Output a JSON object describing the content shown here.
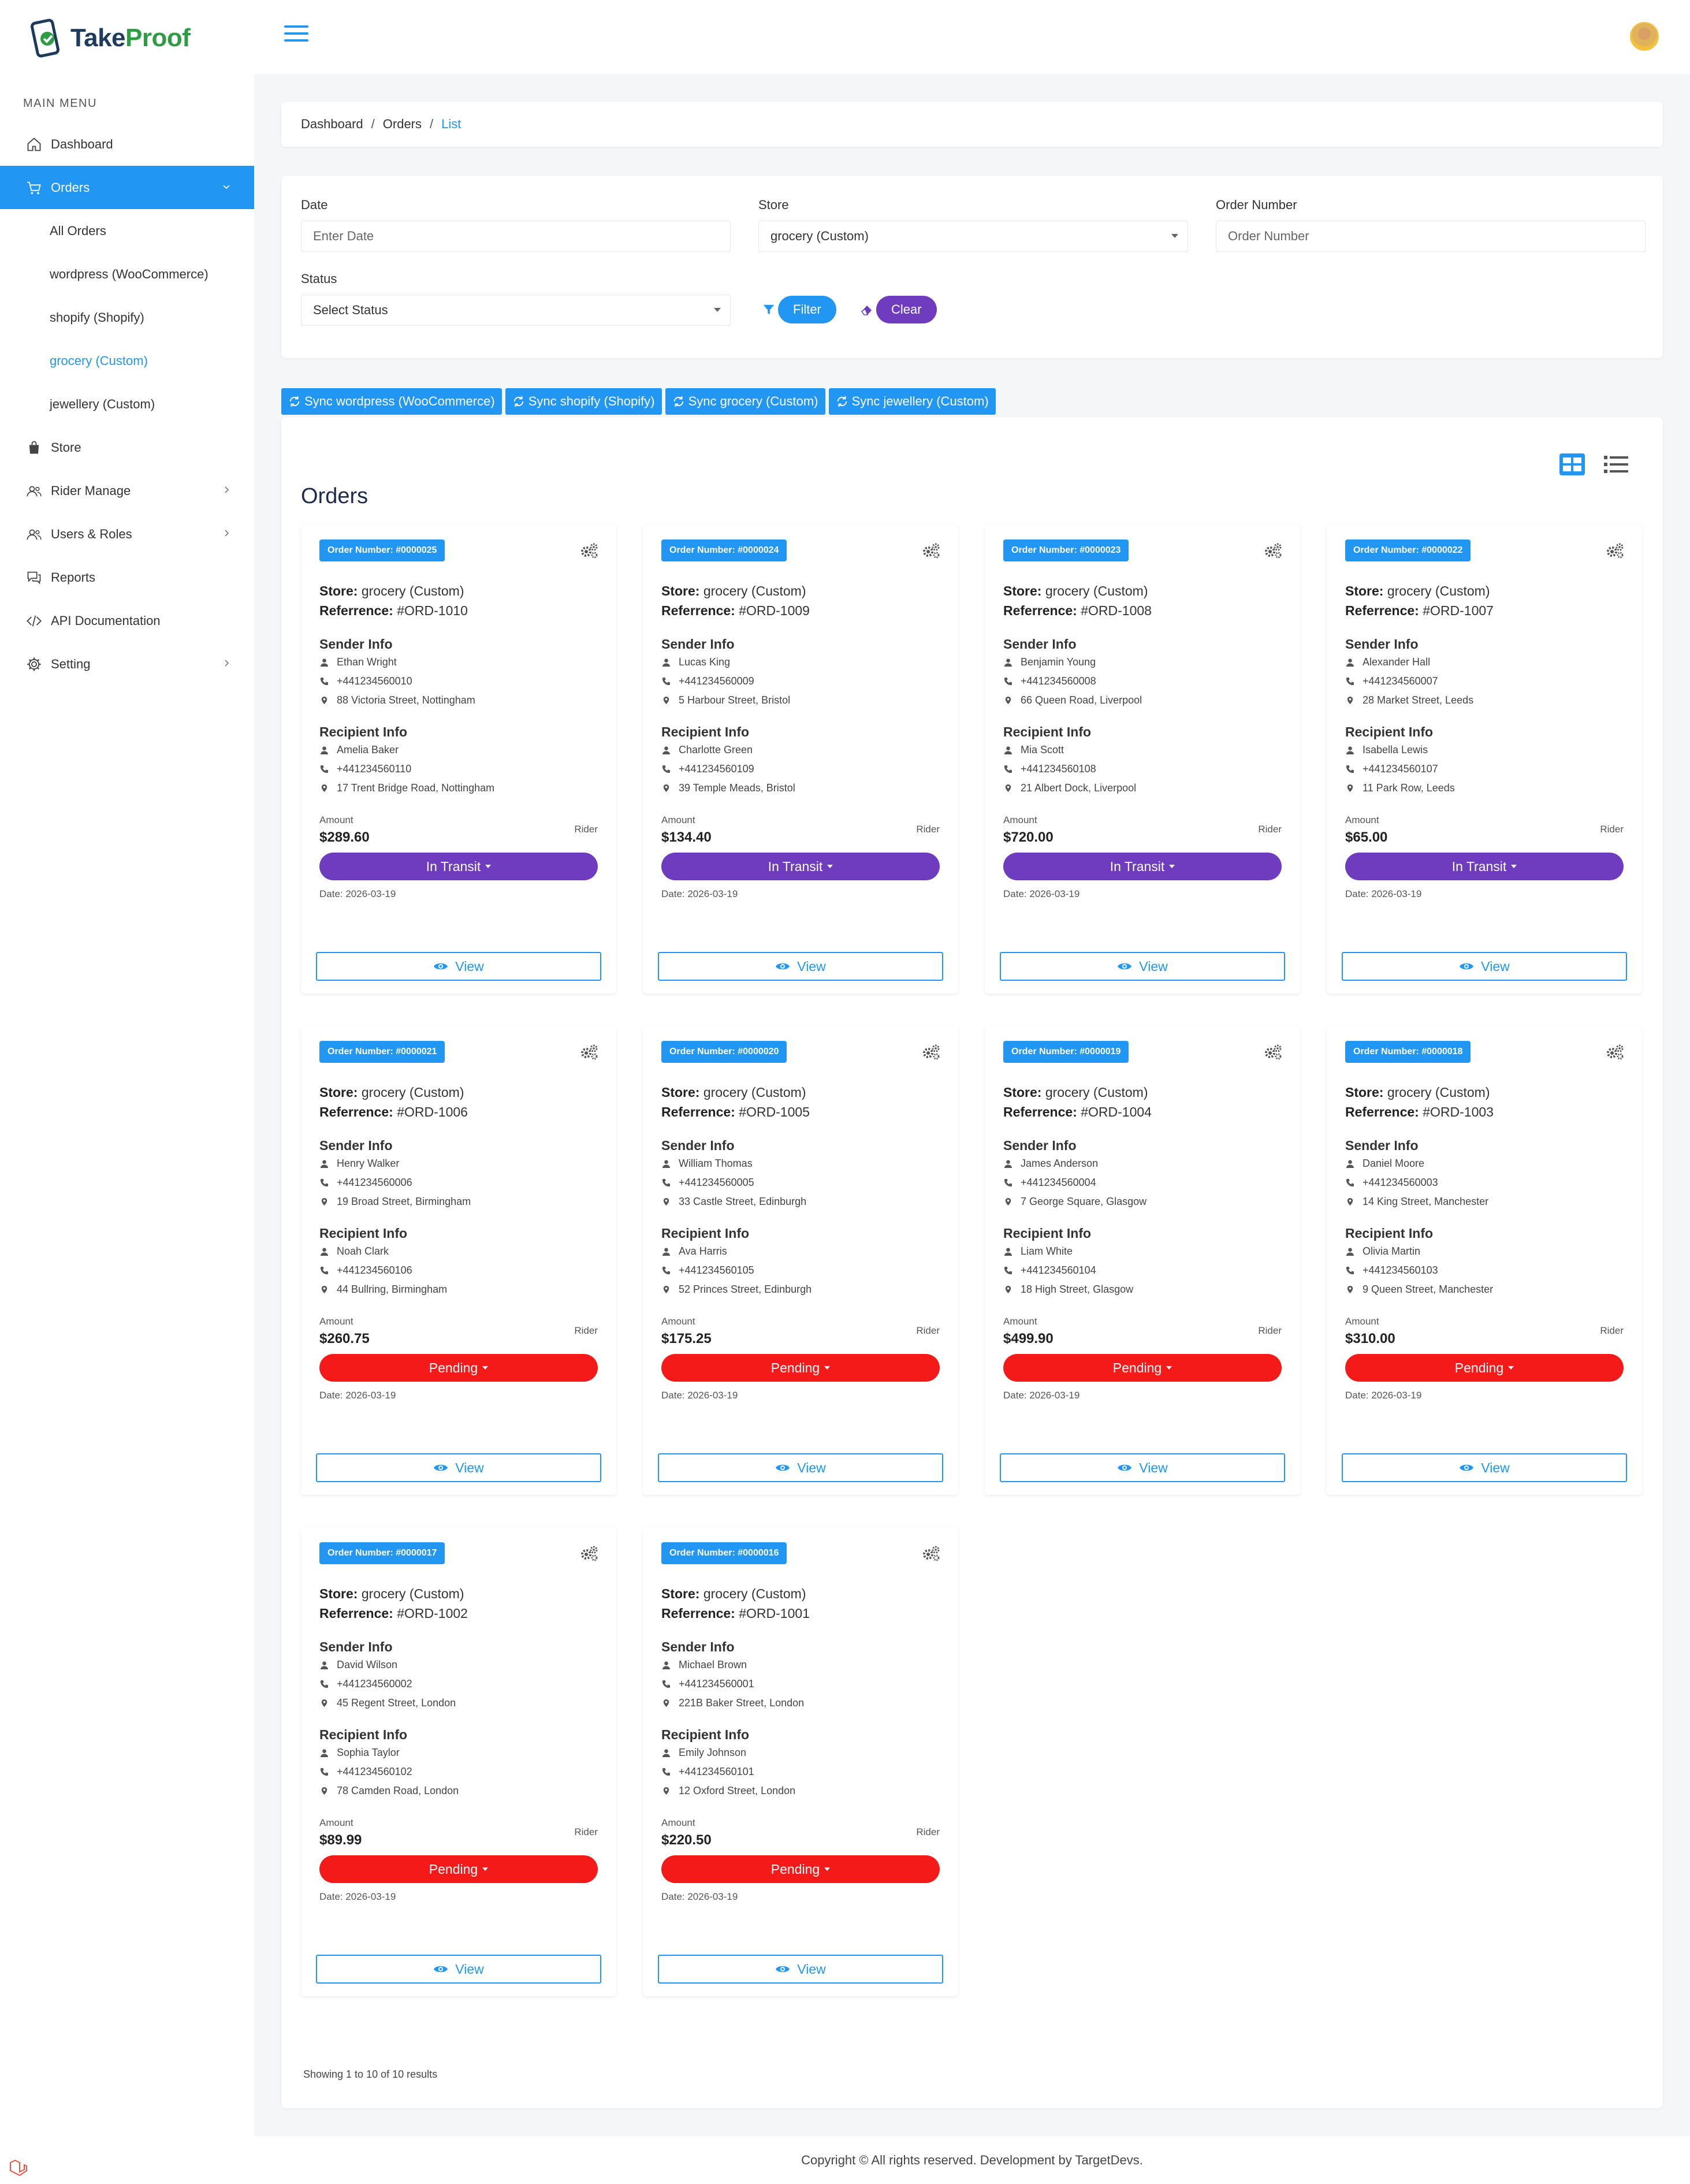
{
  "app": {
    "logo_text_a": "Take",
    "logo_text_b": "Proof"
  },
  "sidebar": {
    "caption": "MAIN MENU",
    "items": [
      {
        "label": "Dashboard",
        "icon": "home-icon"
      },
      {
        "label": "Orders",
        "icon": "cart-icon",
        "active": true
      },
      {
        "label": "Store",
        "icon": "shopping-bag-icon"
      },
      {
        "label": "Rider Manage",
        "icon": "users-icon"
      },
      {
        "label": "Users & Roles",
        "icon": "users-icon"
      },
      {
        "label": "Reports",
        "icon": "chat-icon"
      },
      {
        "label": "API Documentation",
        "icon": "code-icon"
      },
      {
        "label": "Setting",
        "icon": "gear-icon"
      }
    ],
    "orders_sub": [
      "All Orders",
      "wordpress (WooCommerce)",
      "shopify (Shopify)",
      "grocery (Custom)",
      "jewellery (Custom)"
    ]
  },
  "breadcrumb": [
    "Dashboard",
    "Orders",
    "List"
  ],
  "filters": {
    "date_label": "Date",
    "date_placeholder": "Enter Date",
    "store_label": "Store",
    "store_value": "grocery (Custom)",
    "order_label": "Order Number",
    "order_placeholder": "Order Number",
    "status_label": "Status",
    "status_value": "Select Status",
    "filter_button": "Filter",
    "clear_button": "Clear"
  },
  "sync_buttons": [
    "Sync wordpress (WooCommerce)",
    "Sync shopify (Shopify)",
    "Sync grocery (Custom)",
    "Sync jewellery (Custom)"
  ],
  "orders_title": "Orders",
  "labels": {
    "store": "Store:",
    "reference": "Referrence:",
    "sender": "Sender Info",
    "recipient": "Recipient Info",
    "amount": "Amount",
    "rider": "Rider",
    "view": "View"
  },
  "orders": [
    {
      "number": "Order Number: #0000025",
      "store": "grocery (Custom)",
      "ref": "#ORD-1010",
      "s_name": "Ethan Wright",
      "s_phone": "+441234560010",
      "s_addr": "88 Victoria Street, Nottingham",
      "r_name": "Amelia Baker",
      "r_phone": "+441234560110",
      "r_addr": "17 Trent Bridge Road, Nottingham",
      "amount": "$289.60",
      "status": "In Transit",
      "date": "Date: 2026-03-19"
    },
    {
      "number": "Order Number: #0000024",
      "store": "grocery (Custom)",
      "ref": "#ORD-1009",
      "s_name": "Lucas King",
      "s_phone": "+441234560009",
      "s_addr": "5 Harbour Street, Bristol",
      "r_name": "Charlotte Green",
      "r_phone": "+441234560109",
      "r_addr": "39 Temple Meads, Bristol",
      "amount": "$134.40",
      "status": "In Transit",
      "date": "Date: 2026-03-19"
    },
    {
      "number": "Order Number: #0000023",
      "store": "grocery (Custom)",
      "ref": "#ORD-1008",
      "s_name": "Benjamin Young",
      "s_phone": "+441234560008",
      "s_addr": "66 Queen Road, Liverpool",
      "r_name": "Mia Scott",
      "r_phone": "+441234560108",
      "r_addr": "21 Albert Dock, Liverpool",
      "amount": "$720.00",
      "status": "In Transit",
      "date": "Date: 2026-03-19"
    },
    {
      "number": "Order Number: #0000022",
      "store": "grocery (Custom)",
      "ref": "#ORD-1007",
      "s_name": "Alexander Hall",
      "s_phone": "+441234560007",
      "s_addr": "28 Market Street, Leeds",
      "r_name": "Isabella Lewis",
      "r_phone": "+441234560107",
      "r_addr": "11 Park Row, Leeds",
      "amount": "$65.00",
      "status": "In Transit",
      "date": "Date: 2026-03-19"
    },
    {
      "number": "Order Number: #0000021",
      "store": "grocery (Custom)",
      "ref": "#ORD-1006",
      "s_name": "Henry Walker",
      "s_phone": "+441234560006",
      "s_addr": "19 Broad Street, Birmingham",
      "r_name": "Noah Clark",
      "r_phone": "+441234560106",
      "r_addr": "44 Bullring, Birmingham",
      "amount": "$260.75",
      "status": "Pending",
      "date": "Date: 2026-03-19"
    },
    {
      "number": "Order Number: #0000020",
      "store": "grocery (Custom)",
      "ref": "#ORD-1005",
      "s_name": "William Thomas",
      "s_phone": "+441234560005",
      "s_addr": "33 Castle Street, Edinburgh",
      "r_name": "Ava Harris",
      "r_phone": "+441234560105",
      "r_addr": "52 Princes Street, Edinburgh",
      "amount": "$175.25",
      "status": "Pending",
      "date": "Date: 2026-03-19"
    },
    {
      "number": "Order Number: #0000019",
      "store": "grocery (Custom)",
      "ref": "#ORD-1004",
      "s_name": "James Anderson",
      "s_phone": "+441234560004",
      "s_addr": "7 George Square, Glasgow",
      "r_name": "Liam White",
      "r_phone": "+441234560104",
      "r_addr": "18 High Street, Glasgow",
      "amount": "$499.90",
      "status": "Pending",
      "date": "Date: 2026-03-19"
    },
    {
      "number": "Order Number: #0000018",
      "store": "grocery (Custom)",
      "ref": "#ORD-1003",
      "s_name": "Daniel Moore",
      "s_phone": "+441234560003",
      "s_addr": "14 King Street, Manchester",
      "r_name": "Olivia Martin",
      "r_phone": "+441234560103",
      "r_addr": "9 Queen Street, Manchester",
      "amount": "$310.00",
      "status": "Pending",
      "date": "Date: 2026-03-19"
    },
    {
      "number": "Order Number: #0000017",
      "store": "grocery (Custom)",
      "ref": "#ORD-1002",
      "s_name": "David Wilson",
      "s_phone": "+441234560002",
      "s_addr": "45 Regent Street, London",
      "r_name": "Sophia Taylor",
      "r_phone": "+441234560102",
      "r_addr": "78 Camden Road, London",
      "amount": "$89.99",
      "status": "Pending",
      "date": "Date: 2026-03-19"
    },
    {
      "number": "Order Number: #0000016",
      "store": "grocery (Custom)",
      "ref": "#ORD-1001",
      "s_name": "Michael Brown",
      "s_phone": "+441234560001",
      "s_addr": "221B Baker Street, London",
      "r_name": "Emily Johnson",
      "r_phone": "+441234560101",
      "r_addr": "12 Oxford Street, London",
      "amount": "$220.50",
      "status": "Pending",
      "date": "Date: 2026-03-19"
    }
  ],
  "results_info": "Showing 1 to 10 of 10 results",
  "footer": "Copyright © All rights reserved. Development by TargetDevs.",
  "colors": {
    "primary": "#2196f3",
    "in_transit": "#6f3cbf",
    "pending": "#f41a1a"
  }
}
